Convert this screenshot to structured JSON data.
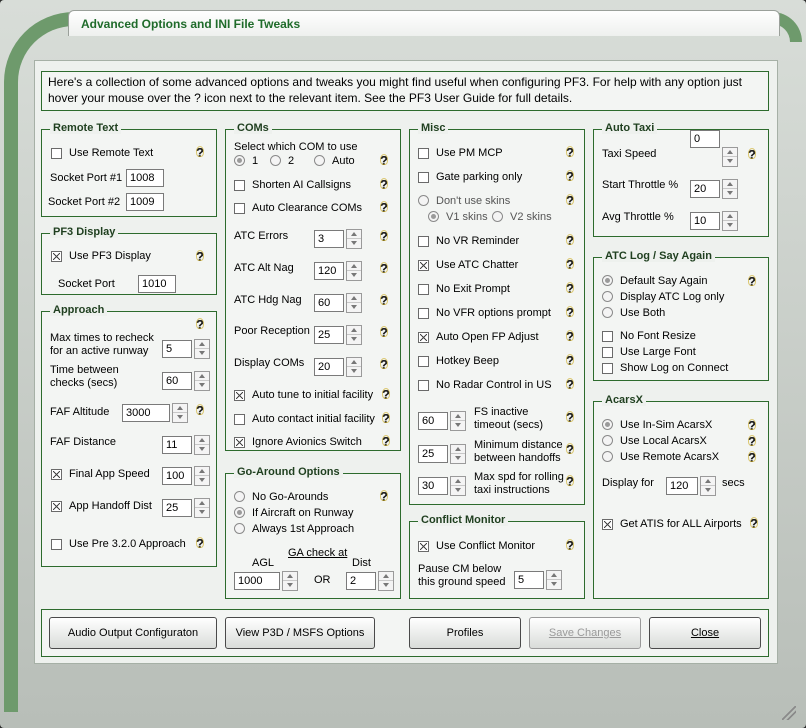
{
  "window": {
    "title": "Advanced Options and INI File Tweaks"
  },
  "intro": "Here's a collection of some advanced options and tweaks you might find useful when configuring PF3. For help with any option just hover your mouse over the ? icon next to the relevant item. See the PF3 User Guide for full details.",
  "remote_text": {
    "legend": "Remote Text",
    "use_remote_text": {
      "label": "Use Remote Text",
      "checked": false
    },
    "port1": {
      "label": "Socket Port #1",
      "value": "1008"
    },
    "port2": {
      "label": "Socket Port #2",
      "value": "1009"
    }
  },
  "pf3_display": {
    "legend": "PF3 Display",
    "use_pf3_display": {
      "label": "Use PF3 Display",
      "checked": true
    },
    "socket_port": {
      "label": "Socket Port",
      "value": "1010"
    }
  },
  "approach": {
    "legend": "Approach",
    "max_recheck": {
      "label_line1": "Max times to recheck",
      "label_line2": "for an active runway",
      "value": "5"
    },
    "time_between": {
      "label_line1": "Time between",
      "label_line2": "checks (secs)",
      "value": "60"
    },
    "faf_altitude": {
      "label": "FAF Altitude",
      "value": "3000"
    },
    "faf_distance": {
      "label": "FAF Distance",
      "value": "11"
    },
    "final_app_speed": {
      "label": "Final App Speed",
      "checked": true,
      "value": "100"
    },
    "app_handoff_dist": {
      "label": "App Handoff Dist",
      "checked": true,
      "value": "25"
    },
    "use_pre_320": {
      "label": "Use Pre 3.2.0 Approach",
      "checked": false
    }
  },
  "coms": {
    "legend": "COMs",
    "select_label": "Select which COM to use",
    "options": [
      "1",
      "2",
      "Auto"
    ],
    "selected": "1",
    "shorten_ai": {
      "label": "Shorten AI Callsigns",
      "checked": false
    },
    "auto_clearance": {
      "label": "Auto Clearance COMs",
      "checked": false
    },
    "atc_errors": {
      "label": "ATC Errors",
      "value": "3"
    },
    "atc_alt_nag": {
      "label": "ATC Alt Nag",
      "value": "120"
    },
    "atc_hdg_nag": {
      "label": "ATC Hdg Nag",
      "value": "60"
    },
    "poor_reception": {
      "label": "Poor Reception",
      "value": "25"
    },
    "display_coms": {
      "label": "Display COMs",
      "value": "20"
    },
    "auto_tune": {
      "label": "Auto tune to initial facility",
      "checked": true
    },
    "auto_contact": {
      "label": "Auto contact initial facility",
      "checked": false
    },
    "ignore_avionics": {
      "label": "Ignore Avionics Switch",
      "checked": true
    }
  },
  "go_around": {
    "legend": "Go-Around Options",
    "options": [
      "No Go-Arounds",
      "If Aircraft on Runway",
      "Always 1st Approach"
    ],
    "selected": "If Aircraft on Runway",
    "ga_check_label": "GA check at",
    "agl_label": "AGL",
    "agl_value": "1000",
    "or_label": "OR",
    "dist_label": "Dist",
    "dist_value": "2"
  },
  "misc": {
    "legend": "Misc",
    "use_pm_mcp": {
      "label": "Use PM MCP",
      "checked": false
    },
    "gate_parking": {
      "label": "Gate parking only",
      "checked": false
    },
    "dont_use_skins": {
      "label": "Don't use skins",
      "selected": false
    },
    "v1_skins": {
      "label": "V1 skins",
      "selected": true
    },
    "v2_skins": {
      "label": "V2 skins",
      "selected": false
    },
    "no_vr_reminder": {
      "label": "No VR Reminder",
      "checked": false
    },
    "use_atc_chatter": {
      "label": "Use ATC Chatter",
      "checked": true
    },
    "no_exit_prompt": {
      "label": "No Exit Prompt",
      "checked": false
    },
    "no_vfr_prompt": {
      "label": "No VFR options  prompt",
      "checked": false
    },
    "auto_open_fp": {
      "label": "Auto Open FP Adjust",
      "checked": true
    },
    "hotkey_beep": {
      "label": "Hotkey Beep",
      "checked": false
    },
    "no_radar": {
      "label": "No Radar Control in US",
      "checked": false
    },
    "fs_inactive": {
      "label_line1": "FS inactive",
      "label_line2": "timeout (secs)",
      "value": "60"
    },
    "min_distance": {
      "label_line1": "Minimum distance",
      "label_line2": "between handoffs",
      "value": "25"
    },
    "max_spd": {
      "label_line1": "Max spd for rolling",
      "label_line2": "taxi instructions",
      "value": "30"
    }
  },
  "conflict_monitor": {
    "legend": "Conflict Monitor",
    "use_cm": {
      "label": "Use Conflict Monitor",
      "checked": true
    },
    "pause_label_line1": "Pause CM below",
    "pause_label_line2": "this ground speed",
    "pause_value": "5"
  },
  "auto_taxi": {
    "legend": "Auto Taxi",
    "taxi_speed": {
      "label": "Taxi Speed",
      "value": "0"
    },
    "start_throttle": {
      "label": "Start Throttle %",
      "value": "20"
    },
    "avg_throttle": {
      "label": "Avg Throttle  %",
      "value": "10"
    }
  },
  "atc_log": {
    "legend": "ATC Log / Say Again",
    "options": [
      "Default Say Again",
      "Display ATC Log only",
      "Use Both"
    ],
    "selected": "Default Say Again",
    "no_font_resize": {
      "label": "No Font Resize",
      "checked": false
    },
    "use_large_font": {
      "label": "Use Large Font",
      "checked": false
    },
    "show_log": {
      "label": "Show Log on Connect",
      "checked": false
    }
  },
  "acarsx": {
    "legend": "AcarsX",
    "options": [
      "Use In-Sim AcarsX",
      "Use Local AcarsX",
      "Use Remote AcarsX"
    ],
    "selected": "Use In-Sim AcarsX",
    "display_for_label": "Display for",
    "display_value": "120",
    "secs_label": "secs",
    "get_atis": {
      "label": "Get ATIS for ALL Airports",
      "checked": true
    }
  },
  "buttons": {
    "audio": "Audio Output Configuraton",
    "view_p3d": "View P3D / MSFS Options",
    "profiles": "Profiles",
    "save": "Save Changes",
    "close": "Close"
  }
}
